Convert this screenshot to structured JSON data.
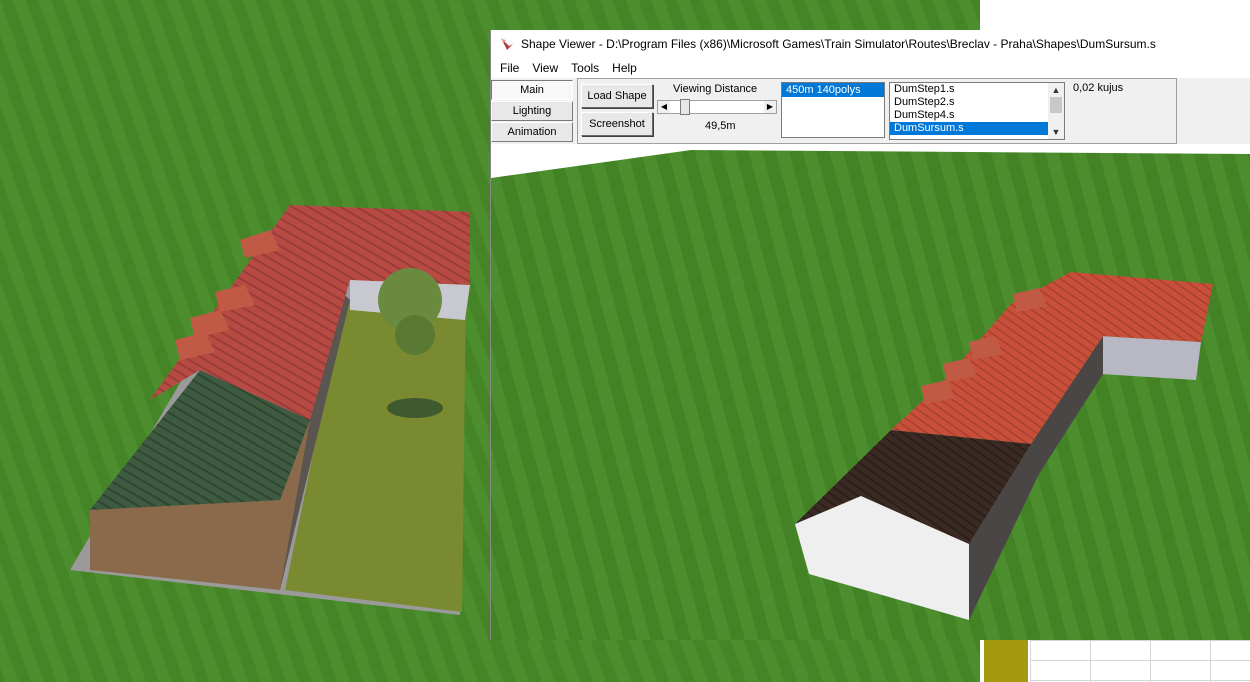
{
  "window": {
    "title": "Shape Viewer - D:\\Program Files (x86)\\Microsoft Games\\Train Simulator\\Routes\\Breclav - Praha\\Shapes\\DumSursum.s"
  },
  "menu": [
    "File",
    "View",
    "Tools",
    "Help"
  ],
  "side_tabs": {
    "main": "Main",
    "lighting": "Lighting",
    "animation": "Animation"
  },
  "buttons": {
    "load_shape": "Load Shape",
    "screenshot": "Screenshot"
  },
  "viewing_distance": {
    "label": "Viewing Distance",
    "value": "49,5m",
    "slider_level": 0.12
  },
  "lod_list": [
    "450m 140polys"
  ],
  "file_list": {
    "items": [
      "DumStep1.s",
      "DumStep2.s",
      "DumStep4.s",
      "DumSursum.s"
    ],
    "selected": "DumSursum.s"
  },
  "size_readout": "0,02 kujus",
  "colors": {
    "grass": "#4a8a2c",
    "roof_red": "#c8503a",
    "roof_dark": "#3a2a24",
    "selection": "#0078d7"
  }
}
